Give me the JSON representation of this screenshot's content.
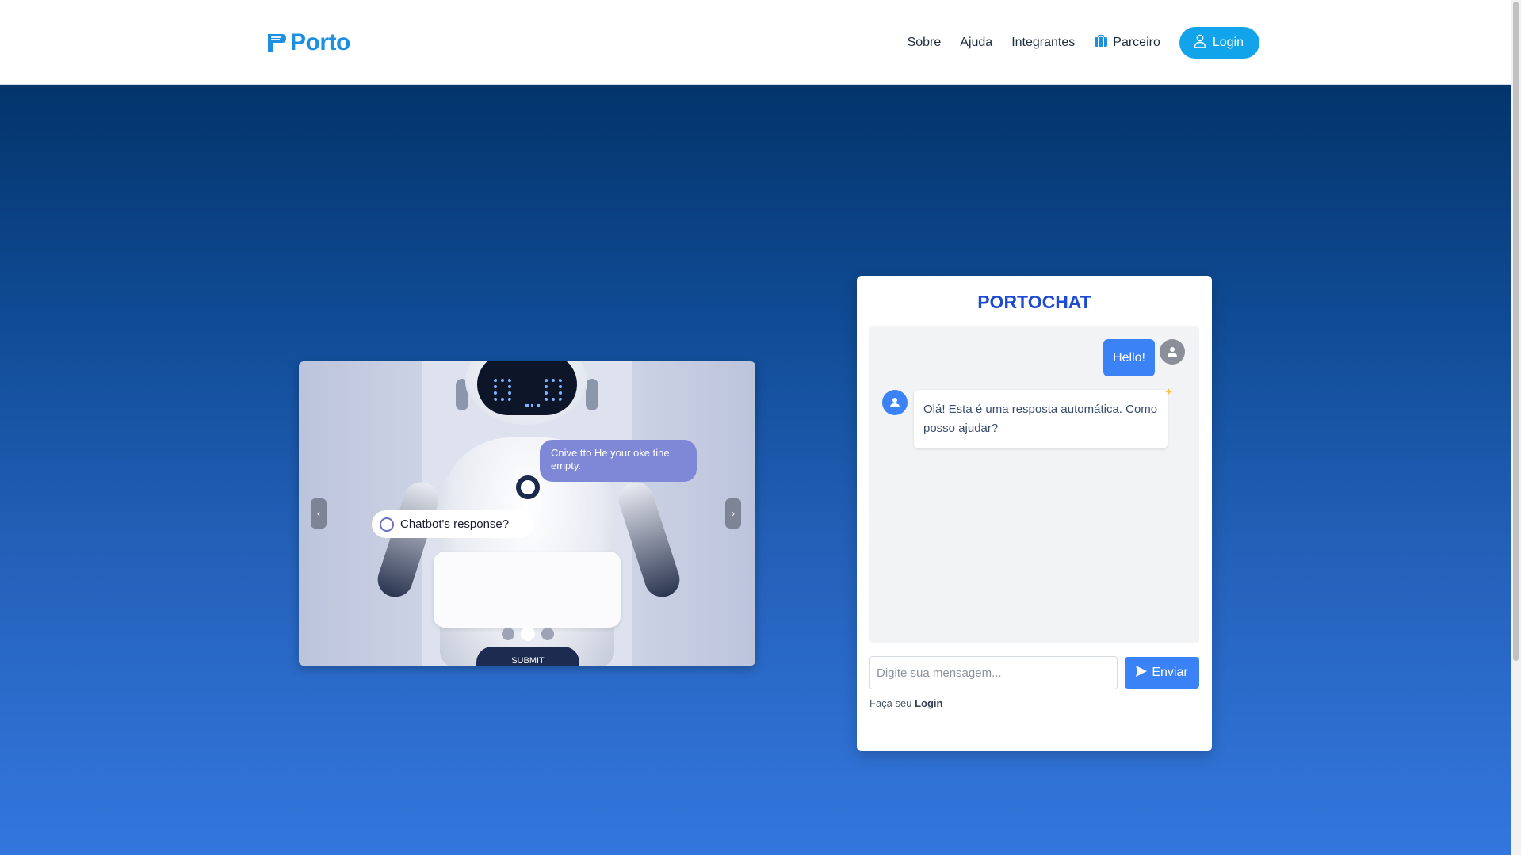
{
  "header": {
    "logo_text": "Porto",
    "nav": {
      "sobre": "Sobre",
      "ajuda": "Ajuda",
      "integrantes": "Integrantes",
      "parceiro": "Parceiro"
    },
    "login_label": "Login"
  },
  "carousel": {
    "bubble_purple": "Cnive tto He your oke tine empty.",
    "bubble_white": "Chatbot's response?",
    "submit_label": "SUBMIT",
    "prev_label": "‹",
    "next_label": "›",
    "slide_count": 3,
    "active_slide": 2
  },
  "chat": {
    "title": "PORTOCHAT",
    "messages": [
      {
        "from": "user",
        "text": "Hello!"
      },
      {
        "from": "bot",
        "text": "Olá! Esta é uma resposta automática. Como posso ajudar?"
      }
    ],
    "input_placeholder": "Digite sua mensagem...",
    "send_label": "Enviar",
    "footer_prefix": "Faça seu",
    "footer_link": "Login"
  },
  "colors": {
    "brand": "#1c8fe0",
    "login_button": "#12a4ea",
    "chat_title": "#1e4bd1",
    "primary_button": "#3b82f6",
    "hero_top": "#03346b",
    "hero_bottom": "#3377de"
  },
  "icons": {
    "parceiro": "briefcase-icon",
    "login": "user-icon",
    "send": "paper-plane-icon"
  }
}
